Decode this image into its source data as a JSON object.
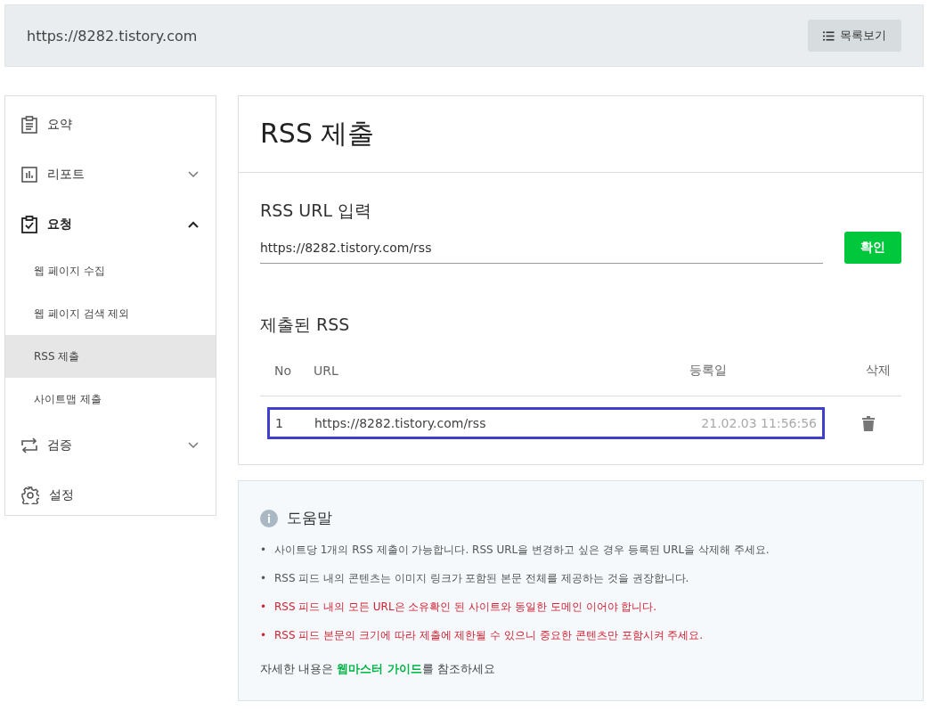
{
  "header": {
    "site_url": "https://8282.tistory.com",
    "list_button": "목록보기"
  },
  "sidebar": {
    "items": [
      {
        "label": "요약",
        "kind": "menu",
        "bold": false
      },
      {
        "label": "리포트",
        "kind": "menu",
        "bold": false,
        "expanded": false
      },
      {
        "label": "요청",
        "kind": "menu",
        "bold": true,
        "expanded": true,
        "children": [
          {
            "label": "웹 페이지 수집",
            "selected": false
          },
          {
            "label": "웹 페이지 검색 제외",
            "selected": false
          },
          {
            "label": "RSS 제출",
            "selected": true
          },
          {
            "label": "사이트맵 제출",
            "selected": false
          }
        ]
      },
      {
        "label": "검증",
        "kind": "menu",
        "bold": false,
        "expanded": false
      },
      {
        "label": "설정",
        "kind": "menu",
        "bold": false
      }
    ]
  },
  "page_title": "RSS 제출",
  "rss_input": {
    "label": "RSS URL 입력",
    "value": "https://8282.tistory.com/rss",
    "button": "확인"
  },
  "submitted": {
    "title": "제출된 RSS",
    "columns": [
      "No",
      "URL",
      "등록일",
      "삭제"
    ],
    "rows": [
      {
        "no": "1",
        "url": "https://8282.tistory.com/rss",
        "date": "21.02.03 11:56:56",
        "selected": true
      }
    ]
  },
  "help": {
    "title": "도움말",
    "items": [
      {
        "bullet": "•",
        "text": "사이트당 1개의 RSS 제출이 가능합니다. RSS URL을 변경하고 싶은 경우 등록된 URL을 삭제해 주세요.",
        "kind": "note"
      },
      {
        "bullet": "•",
        "text": "RSS 피드 내의 콘텐츠는 이미지 링크가 포함된 본문 전체를 제공하는 것을 권장합니다.",
        "kind": "note"
      },
      {
        "bullet": "•",
        "text": "RSS 피드 내의 모든 URL은 소유확인 된 사이트와 동일한 도메인 이어야 합니다.",
        "kind": "warning"
      },
      {
        "bullet": "•",
        "text": "RSS 피드 본문의 크기에 따라 제출에 제한될 수 있으니 중요한 콘텐츠만 포함시켜 주세요.",
        "kind": "warning"
      }
    ],
    "footer": {
      "before": "자세한 내용은 ",
      "link": "웹마스터 가이드",
      "after": "를 참조하세요"
    }
  }
}
